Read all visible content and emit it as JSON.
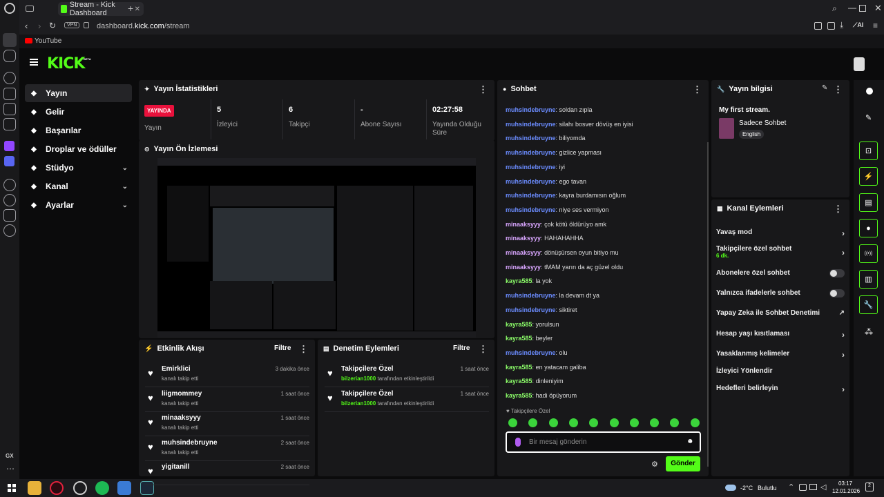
{
  "browser": {
    "tab_title": "Stream - Kick Dashboard",
    "vpn": "VPN",
    "url_domain": "dashboard.",
    "url_host": "kick.com",
    "url_path": "/stream",
    "bookmark": "YouTube",
    "ai": "AI"
  },
  "brand": {
    "logo": "KICK",
    "beta": "BETA",
    "accent": "#53fc18"
  },
  "nav": [
    {
      "label": "Yayın",
      "icon": "broadcast-icon"
    },
    {
      "label": "Gelir",
      "icon": "revenue-icon"
    },
    {
      "label": "Başarılar",
      "icon": "trophy-icon"
    },
    {
      "label": "Droplar ve ödüller",
      "icon": "gift-icon"
    },
    {
      "label": "Stüdyo",
      "icon": "studio-icon"
    },
    {
      "label": "Kanal",
      "icon": "channel-icon"
    },
    {
      "label": "Ayarlar",
      "icon": "settings-icon"
    }
  ],
  "stats": {
    "title": "Yayın İstatistikleri",
    "live_badge": "YAYINDA",
    "live_label": "Yayın",
    "items": [
      {
        "value": "5",
        "label": "İzleyici"
      },
      {
        "value": "6",
        "label": "Takipçi"
      },
      {
        "value": "-",
        "label": "Abone Sayısı"
      },
      {
        "value": "02:27:58",
        "label": "Yayında Olduğu Süre"
      }
    ]
  },
  "preview": {
    "title": "Yayın Ön İzlemesi"
  },
  "events": {
    "title": "Etkinlik Akışı",
    "filter": "Filtre",
    "items": [
      {
        "name": "Emirklici",
        "sub": "kanalı takip etti",
        "time": "3 dakika önce"
      },
      {
        "name": "liigmommey",
        "sub": "kanalı takip etti",
        "time": "1 saat önce"
      },
      {
        "name": "minaaksyyy",
        "sub": "kanalı takip etti",
        "time": "1 saat önce"
      },
      {
        "name": "muhsindebruyne",
        "sub": "kanalı takip etti",
        "time": "2 saat önce"
      },
      {
        "name": "yigitanill",
        "sub": "",
        "time": "2 saat önce"
      }
    ]
  },
  "moderation": {
    "title": "Denetim Eylemleri",
    "filter": "Filtre",
    "items": [
      {
        "title": "Takipçilere Özel",
        "user": "bilzerian1000",
        "suffix": "tarafından etkinleştirildi",
        "time": "1 saat önce"
      },
      {
        "title": "Takipçilere Özel",
        "user": "bilzerian1000",
        "suffix": "tarafından etkinleştirildi",
        "time": "1 saat önce"
      }
    ]
  },
  "chat": {
    "title": "Sohbet",
    "followers_only": "Takipçilere Özel",
    "placeholder": "Bir mesaj gönderin",
    "send": "Gönder",
    "messages": [
      {
        "user": "muhsindebruyne",
        "color": "#6b8cff",
        "text": "soldan zıpla"
      },
      {
        "user": "muhsindebruyne",
        "color": "#6b8cff",
        "text": "silahı bosver dövüş en iyisi"
      },
      {
        "user": "muhsindebruyne",
        "color": "#6b8cff",
        "text": "biliyomda"
      },
      {
        "user": "muhsindebruyne",
        "color": "#6b8cff",
        "text": "gizlice yapması"
      },
      {
        "user": "muhsindebruyne",
        "color": "#6b8cff",
        "text": "iyi"
      },
      {
        "user": "muhsindebruyne",
        "color": "#6b8cff",
        "text": "ego tavan"
      },
      {
        "user": "muhsindebruyne",
        "color": "#6b8cff",
        "text": "kayra burdamısın oğlum"
      },
      {
        "user": "muhsindebruyne",
        "color": "#6b8cff",
        "text": "niye ses vermiyon"
      },
      {
        "user": "minaaksyyy",
        "color": "#d9a6ff",
        "text": "çok kötü öldürüyo amk"
      },
      {
        "user": "minaaksyyy",
        "color": "#d9a6ff",
        "text": "HAHAHAHHA"
      },
      {
        "user": "minaaksyyy",
        "color": "#d9a6ff",
        "text": "dönüşürsen oyun bitiyo mu"
      },
      {
        "user": "minaaksyyy",
        "color": "#d9a6ff",
        "text": "tMAM yarın da aç güzel oldu"
      },
      {
        "user": "kayra585",
        "color": "#8dff6a",
        "text": "la yok"
      },
      {
        "user": "muhsindebruyne",
        "color": "#6b8cff",
        "text": "la devam dt ya"
      },
      {
        "user": "muhsindebruyne",
        "color": "#6b8cff",
        "text": "siktiret"
      },
      {
        "user": "kayra585",
        "color": "#8dff6a",
        "text": "yorulsun"
      },
      {
        "user": "kayra585",
        "color": "#8dff6a",
        "text": "beyler"
      },
      {
        "user": "muhsindebruyne",
        "color": "#6b8cff",
        "text": "olu"
      },
      {
        "user": "kayra585",
        "color": "#8dff6a",
        "text": "en yatacam galiba"
      },
      {
        "user": "kayra585",
        "color": "#8dff6a",
        "text": "dinleniyim"
      },
      {
        "user": "kayra585",
        "color": "#8dff6a",
        "text": "hadi öpüyorum"
      }
    ]
  },
  "stream_info": {
    "title": "Yayın bilgisi",
    "stream_title": "My first stream.",
    "category": "Sadece Sohbet",
    "language": "English"
  },
  "channel_actions": {
    "title": "Kanal Eylemleri",
    "items": [
      {
        "label": "Yavaş mod",
        "type": "arrow"
      },
      {
        "label": "Takipçilere özel sohbet",
        "sub": "6 dk.",
        "type": "arrow"
      },
      {
        "label": "Abonelere özel sohbet",
        "type": "toggle"
      },
      {
        "label": "Yalnızca ifadelerle sohbet",
        "type": "toggle"
      },
      {
        "label": "Yapay Zeka ile Sohbet Denetimi",
        "type": "external"
      },
      {
        "label": "Hesap yaşı kısıtlaması",
        "type": "arrow"
      },
      {
        "label": "Yasaklanmış kelimeler",
        "type": "arrow"
      },
      {
        "label": "İzleyici Yönlendir",
        "type": "none"
      },
      {
        "label": "Hedefleri belirleyin",
        "type": "arrow"
      }
    ]
  },
  "taskbar": {
    "weather": "-2°C",
    "weather_text": "Bulutlu",
    "time": "03:17",
    "date": "12.01.2026",
    "notif": "2"
  }
}
